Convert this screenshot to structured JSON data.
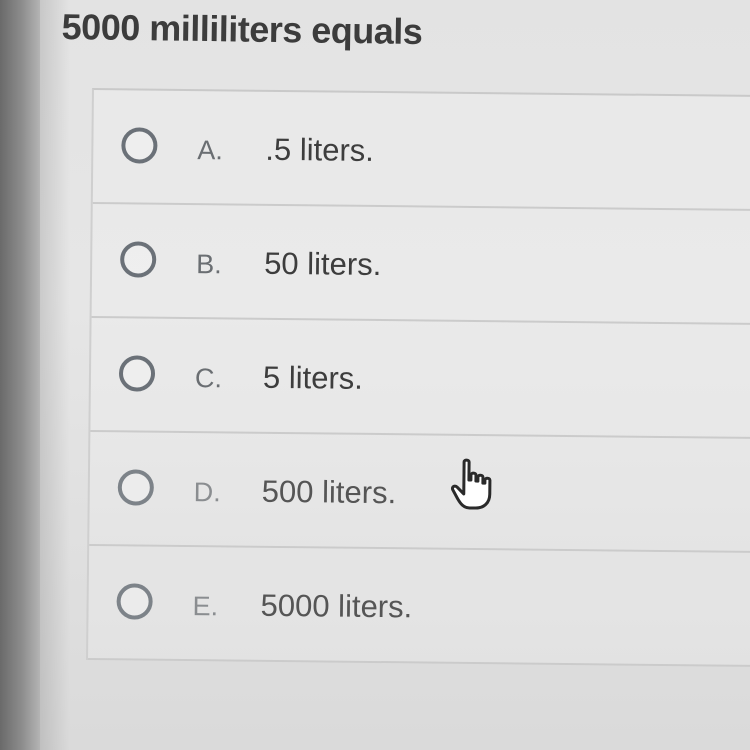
{
  "question": {
    "text": "5000 milliliters equals"
  },
  "options": [
    {
      "letter": "A.",
      "text": ".5 liters."
    },
    {
      "letter": "B.",
      "text": "50 liters."
    },
    {
      "letter": "C.",
      "text": "5 liters."
    },
    {
      "letter": "D.",
      "text": "500 liters."
    },
    {
      "letter": "E.",
      "text": "5000 liters."
    }
  ],
  "cursor": {
    "icon": "hand-pointer-icon",
    "hovered_option": "D."
  },
  "colors": {
    "background": "#e4e4e4",
    "question_text": "#3c3c3c",
    "radio_border": "#6b7178",
    "divider": "#cbcbcb"
  }
}
